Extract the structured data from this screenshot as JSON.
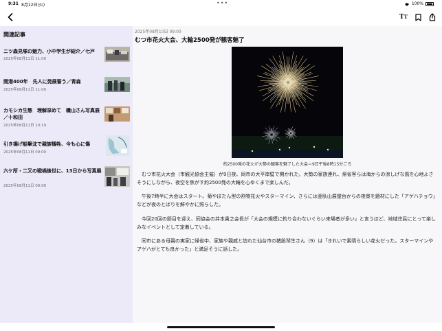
{
  "status": {
    "time": "9:31",
    "date": "8月12日(火)",
    "battery": "100%"
  },
  "sidebar": {
    "title": "関連記事",
    "items": [
      {
        "title": "ニツ森見塚の魅力、小中学生が紹介／七戸",
        "date": "2025年08月11日 11:00"
      },
      {
        "title": "開港400年　先人に発展誓う／青森",
        "date": "2025年08月11日 11:00"
      },
      {
        "title": "カモシカ生態　理解深めて　磯山さん写真展／十和田",
        "date": "2025年08月11日 10:19"
      },
      {
        "title": "引き揚げ船撃沈で親族犠牲、今も心に傷",
        "date": "2025年08月11日 09:00"
      },
      {
        "title": "六ケ所・二又の戦禍後世に、13日から写真展",
        "date": "2025年08月11日 09:00"
      }
    ]
  },
  "article": {
    "date": "2025年08月10日 09:00",
    "title": "むつ市花火大会、大輪2500発が観客魅了",
    "caption": "約2500発の花火が大勢の観客を魅了した大会＝9日午後8時15分ごろ",
    "paragraphs": [
      "むつ市花火大会（市観光協会主催）が9日夜、同市の大平岸壁で開かれた。大勢の家族連れ、帰省客らは海からの涼しげな風を心地よさそうにしながら、夜空を焦がす約2500発の大輪を心ゆくまで楽しんだ。",
      "午後7時半に大会はスタート。菊やぼたん型の割物花火やスターマイン、さらには釜臥山展望台からの夜景を題材にした「アゲハチョウ」などが夜のとばりを鮮やかに照らした。",
      "今回20回の節目を迎え、同協会の井本貴之会長が「大会の規模に釣り合わないぐらい来場者が多い」と言うほど、地域住民にとって楽しみなイベントとして定着している。",
      "同市にある母親の実家に帰省中、家族や親戚と訪れた仙台市の猪股琴生さん（9）は「きれいで素晴らしい花火だった。スターマインやアゲハがとても良かった」と満足そうに話した。"
    ]
  },
  "icons": {
    "back": "chevron-left-icon",
    "font_size": "text-size-icon",
    "bookmark": "bookmark-icon",
    "share": "share-icon"
  },
  "colors": {
    "sidebar_bg": "#eceaf8",
    "article_bg": "#f7f7f9"
  }
}
